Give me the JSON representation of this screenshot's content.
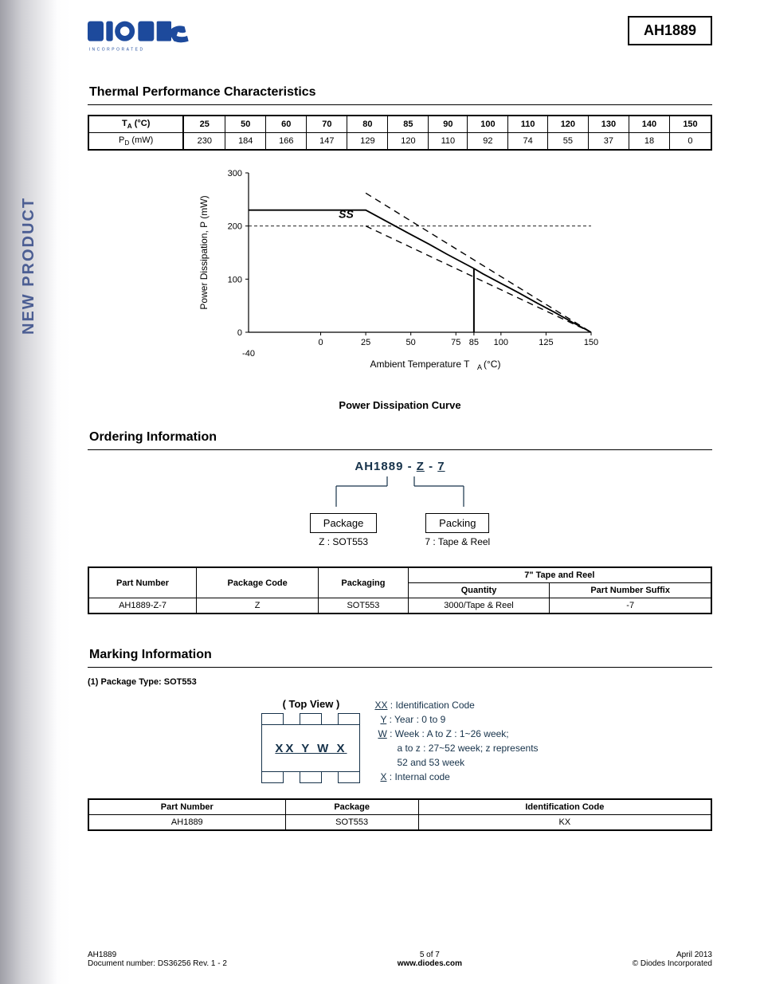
{
  "header": {
    "part_number": "AH1889",
    "logo_text": "DIODES",
    "logo_sub": "INCORPORATED"
  },
  "sidebar": {
    "label": "NEW PRODUCT"
  },
  "section1": {
    "title": "Thermal Performance Characteristics",
    "row1_label_html": "T<sub>A</sub> (°C)",
    "row2_label_html": "P<sub>D</sub> (mW)"
  },
  "chart_data": {
    "type": "line",
    "title": "Power Dissipation Curve",
    "xlabel": "Ambient Temperature  T_A (°C)",
    "ylabel": "Power Dissipation, P_D (mW)",
    "xlim": [
      -40,
      150
    ],
    "ylim": [
      0,
      300
    ],
    "x_ticks": [
      0,
      25,
      50,
      75,
      85,
      100,
      125,
      150
    ],
    "x_extra_label": "-40",
    "y_ticks": [
      0,
      100,
      200,
      300
    ],
    "grid_y": [
      200
    ],
    "annotation": "SS",
    "series": [
      {
        "name": "solid",
        "style": "solid",
        "points": [
          [
            -40,
            230
          ],
          [
            25,
            230
          ],
          [
            50,
            184
          ],
          [
            60,
            166
          ],
          [
            70,
            147
          ],
          [
            80,
            129
          ],
          [
            85,
            120
          ],
          [
            90,
            110
          ],
          [
            100,
            92
          ],
          [
            110,
            74
          ],
          [
            120,
            55
          ],
          [
            130,
            37
          ],
          [
            140,
            18
          ],
          [
            150,
            0
          ]
        ]
      },
      {
        "name": "upper-dash",
        "style": "dash",
        "points": [
          [
            25,
            262
          ],
          [
            150,
            0
          ]
        ]
      },
      {
        "name": "lower-dash",
        "style": "dash",
        "points": [
          [
            25,
            200
          ],
          [
            150,
            0
          ]
        ]
      }
    ],
    "marker_line_x": 85,
    "table": {
      "ta": [
        25,
        50,
        60,
        70,
        80,
        85,
        90,
        100,
        110,
        120,
        130,
        140,
        150
      ],
      "pd": [
        230,
        184,
        166,
        147,
        129,
        120,
        110,
        92,
        74,
        55,
        37,
        18,
        0
      ]
    }
  },
  "section2": {
    "title": "Ordering Information",
    "diagram_top": "AH1889 - Z - 7",
    "package_label": "Package",
    "package_value": "Z : SOT553",
    "packing_label": "Packing",
    "packing_value": "7 : Tape & Reel",
    "table": {
      "headers": [
        "Part Number",
        "Package Code",
        "Packaging"
      ],
      "group_header": "7\" Tape and Reel",
      "sub_headers": [
        "Quantity",
        "Part Number Suffix"
      ],
      "rows": [
        {
          "part_number": "AH1889-Z-7",
          "package_code": "Z",
          "packaging": "SOT553",
          "quantity": "3000/Tape & Reel",
          "suffix": "-7"
        }
      ]
    }
  },
  "section3": {
    "title": "Marking Information",
    "subtitle": "(1)   Package Type: SOT553",
    "top_view_label": "( Top View )",
    "chip_marking": "XX  Y W X",
    "legend": {
      "xx": "XX : Identification Code",
      "y": "Y : Year : 0 to 9",
      "w": "W : Week : A to Z : 1~26 week;",
      "w2": "a to z : 27~52 week; z represents",
      "w3": "52 and 53 week",
      "x": "X : Internal code"
    },
    "table": {
      "headers": [
        "Part Number",
        "Package",
        "Identification Code"
      ],
      "rows": [
        {
          "part_number": "AH1889",
          "package": "SOT553",
          "code": "KX"
        }
      ]
    }
  },
  "footer": {
    "left_line1": "AH1889",
    "left_line2": "Document number: DS36256  Rev. 1 - 2",
    "center_line1": "5 of 7",
    "center_line2": "www.diodes.com",
    "right_line1": "April 2013",
    "right_line2": "© Diodes Incorporated"
  }
}
